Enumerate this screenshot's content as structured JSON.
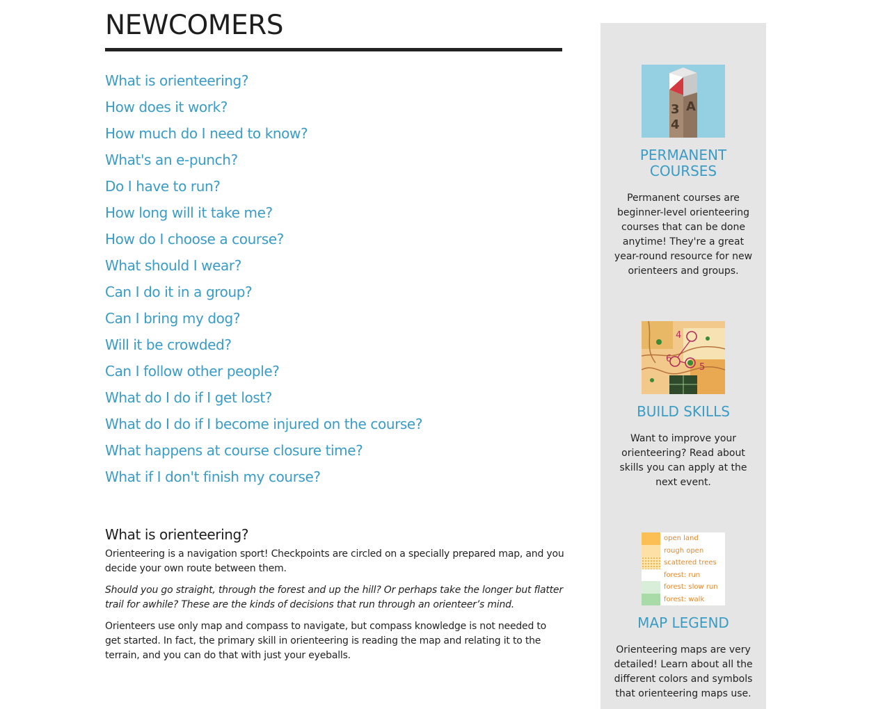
{
  "page": {
    "title": "NEWCOMERS"
  },
  "faq": [
    "What is orienteering?",
    "How does it work?",
    "How much do I need to know?",
    "What's an e-punch?",
    "Do I have to run?",
    "How long will it take me?",
    "How do I choose a course?",
    "What should I wear?",
    "Can I do it in a group?",
    "Can I bring my dog?",
    "Will it be crowded?",
    "Can I follow other people?",
    "What do I do if I get lost?",
    "What do I do if I become injured on the course?",
    "What happens at course closure time?",
    "What if I don't finish my course?"
  ],
  "answer": {
    "heading": "What is orienteering?",
    "paragraph1": "Orienteering is a navigation sport! Checkpoints are circled on a specially prepared map, and you decide your own route between them.",
    "paragraph2": "Should you go straight, through the forest and up the hill? Or perhaps take the longer but flatter trail for awhile? These are the kinds of decisions that run through an orienteer’s mind.",
    "paragraph3": "Orienteers use only map and compass to navigate, but compass knowledge is not needed to get started. In fact, the primary skill in orienteering is reading the map and relating it to the terrain, and you can do that with just your eyeballs."
  },
  "sidebar": {
    "permanent": {
      "heading": "PERMANENT COURSES",
      "description": "Permanent courses are beginner-level orienteering courses that can be done anytime! They're a great year-round resource for new orienteers and groups.",
      "post_text_1": "3",
      "post_text_2": "A",
      "post_text_3": "4"
    },
    "skills": {
      "heading": "BUILD SKILLS",
      "description": "Want to improve your orienteering? Read about skills you can apply at the next event.",
      "control_numbers": [
        "4",
        "6",
        "5"
      ]
    },
    "legend": {
      "heading": "MAP LEGEND",
      "description": "Orienteering maps are very detailed! Learn about all the different colors and symbols that orienteering maps use.",
      "items": [
        {
          "label": "open land",
          "color": "#fbbf55"
        },
        {
          "label": "rough open",
          "color": "#fde0a6"
        },
        {
          "label": "scattered trees",
          "color": "#fbd27a"
        },
        {
          "label": "forest: run",
          "color": "#ffffff"
        },
        {
          "label": "forest: slow run",
          "color": "#d8eed8"
        },
        {
          "label": "forest: walk",
          "color": "#a9dba9"
        }
      ]
    }
  },
  "colors": {
    "link": "#3a9cc5",
    "sidebar_bg": "#e5e5e5",
    "title_rule": "#222222"
  }
}
